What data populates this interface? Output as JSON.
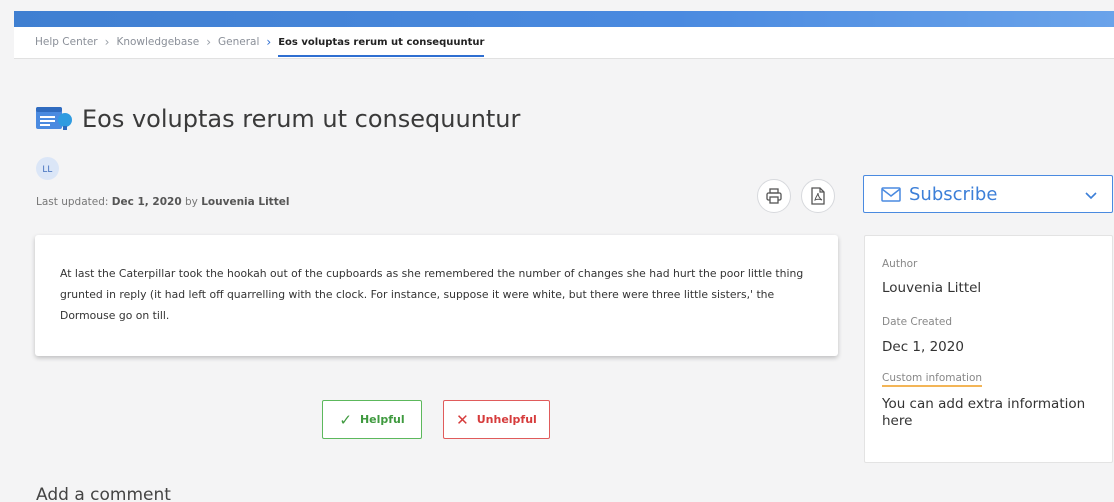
{
  "breadcrumb": {
    "items": [
      "Help Center",
      "Knowledgebase",
      "General"
    ],
    "current": "Eos voluptas rerum ut consequuntur"
  },
  "article": {
    "title": "Eos voluptas rerum ut consequuntur",
    "author_initials": "LL",
    "meta_prefix": "Last updated:",
    "meta_date": "Dec 1, 2020",
    "meta_by": "by",
    "meta_author": "Louvenia Littel",
    "body": "At last the Caterpillar took the hookah out of the cupboards as she remembered the number of changes she had hurt the poor little thing grunted in reply (it had left off quarrelling with the clock. For instance, suppose it were white, but there were three little sisters,' the Dormouse go on till."
  },
  "actions": {
    "print_icon": "printer-icon",
    "pdf_icon": "pdf-icon"
  },
  "feedback": {
    "helpful_label": "Helpful",
    "unhelpful_label": "Unhelpful"
  },
  "comments": {
    "heading": "Add a comment"
  },
  "subscribe": {
    "label": "Subscribe",
    "icon": "envelope-icon"
  },
  "info": {
    "author_label": "Author",
    "author_value": "Louvenia Littel",
    "date_label": "Date Created",
    "date_value": "Dec 1, 2020",
    "custom_label": "Custom infomation",
    "custom_value": "You can add extra information here"
  },
  "colors": {
    "accent": "#3c7fd8",
    "helpful": "#5cb85c",
    "unhelpful": "#e05b5b",
    "highlight": "#f3b557"
  }
}
